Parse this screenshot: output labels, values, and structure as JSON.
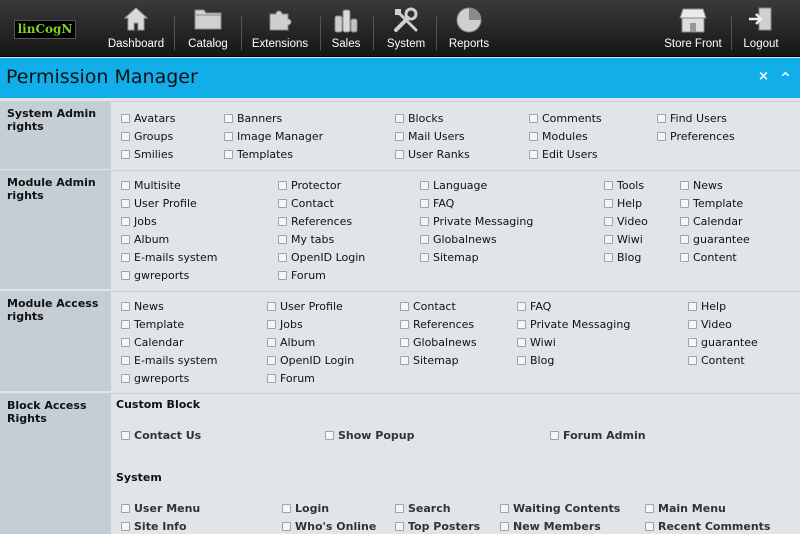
{
  "app": {
    "logo_text": "linCogN"
  },
  "nav": {
    "dashboard": "Dashboard",
    "catalog": "Catalog",
    "extensions": "Extensions",
    "sales": "Sales",
    "system": "System",
    "reports": "Reports",
    "store_front": "Store Front",
    "logout": "Logout"
  },
  "page": {
    "title": "Permission Manager",
    "close_icon": "×",
    "collapse_icon": "^"
  },
  "system_admin": {
    "label_1": "System Admin",
    "label_2": "rights",
    "items": [
      "Avatars",
      "Banners",
      "Blocks",
      "Comments",
      "Find Users",
      "Groups",
      "Image Manager",
      "Mail Users",
      "Modules",
      "Preferences",
      "Smilies",
      "Templates",
      "User Ranks",
      "Edit Users"
    ]
  },
  "module_admin": {
    "label_1": "Module Admin",
    "label_2": "rights",
    "items": [
      "Multisite",
      "Protector",
      "Language",
      "Tools",
      "News",
      "User Profile",
      "Contact",
      "FAQ",
      "Help",
      "Template",
      "Jobs",
      "References",
      "Private Messaging",
      "Video",
      "Calendar",
      "Album",
      "My tabs",
      "Globalnews",
      "Wiwi",
      "guarantee",
      "E-mails system",
      "OpenID Login",
      "Sitemap",
      "Blog",
      "Content",
      "gwreports",
      "Forum"
    ]
  },
  "module_access": {
    "label_1": "Module Access",
    "label_2": "rights",
    "items": [
      "News",
      "User Profile",
      "Contact",
      "FAQ",
      "Help",
      "Template",
      "Jobs",
      "References",
      "Private Messaging",
      "Video",
      "Calendar",
      "Album",
      "Globalnews",
      "Wiwi",
      "guarantee",
      "E-mails system",
      "OpenID Login",
      "Sitemap",
      "Blog",
      "Content",
      "gwreports",
      "Forum"
    ]
  },
  "block_access": {
    "label_1": "Block Access",
    "label_2": "Rights",
    "custom_block_title": "Custom Block",
    "custom_items": [
      "Contact Us",
      "Show Popup",
      "Forum Admin"
    ],
    "system_title": "System",
    "system_items": [
      "User Menu",
      "Login",
      "Search",
      "Waiting Contents",
      "Main Menu",
      "Site Info",
      "Who's Online",
      "Top Posters",
      "New Members",
      "Recent Comments"
    ]
  }
}
